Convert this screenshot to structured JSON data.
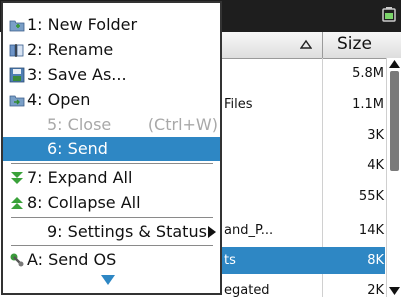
{
  "menu": {
    "items": [
      {
        "label": "1: New Folder",
        "icon": "new-folder-icon"
      },
      {
        "label": "2: Rename",
        "icon": "rename-icon"
      },
      {
        "label": "3: Save As...",
        "icon": "save-as-icon"
      },
      {
        "label": "4: Open",
        "icon": "open-folder-icon"
      },
      {
        "label": "5: Close",
        "shortcut": "(Ctrl+W)",
        "disabled": true
      },
      {
        "label": "6: Send",
        "selected": true
      },
      {
        "label": "7: Expand All",
        "icon": "expand-all-icon"
      },
      {
        "label": "8: Collapse All",
        "icon": "collapse-all-icon"
      },
      {
        "label": "9: Settings & Status",
        "has_submenu": true
      },
      {
        "label": "A: Send OS",
        "icon": "send-os-icon"
      }
    ],
    "more_icon": "more-down-arrow-icon"
  },
  "list": {
    "column_size": "Size",
    "rows": [
      {
        "name": "",
        "size": "5.8M"
      },
      {
        "name": "Files",
        "size": "1.1M"
      },
      {
        "name": "",
        "size": "3K"
      },
      {
        "name": "",
        "size": "4K"
      },
      {
        "name": "",
        "size": "55K"
      },
      {
        "name": "and_P...",
        "size": "14K"
      },
      {
        "name": "ts",
        "size": "8K",
        "selected": true
      },
      {
        "name": "egated",
        "size": "2K"
      }
    ]
  },
  "colors": {
    "accent": "#2e87c4",
    "topbar": "#1e1e1e"
  }
}
